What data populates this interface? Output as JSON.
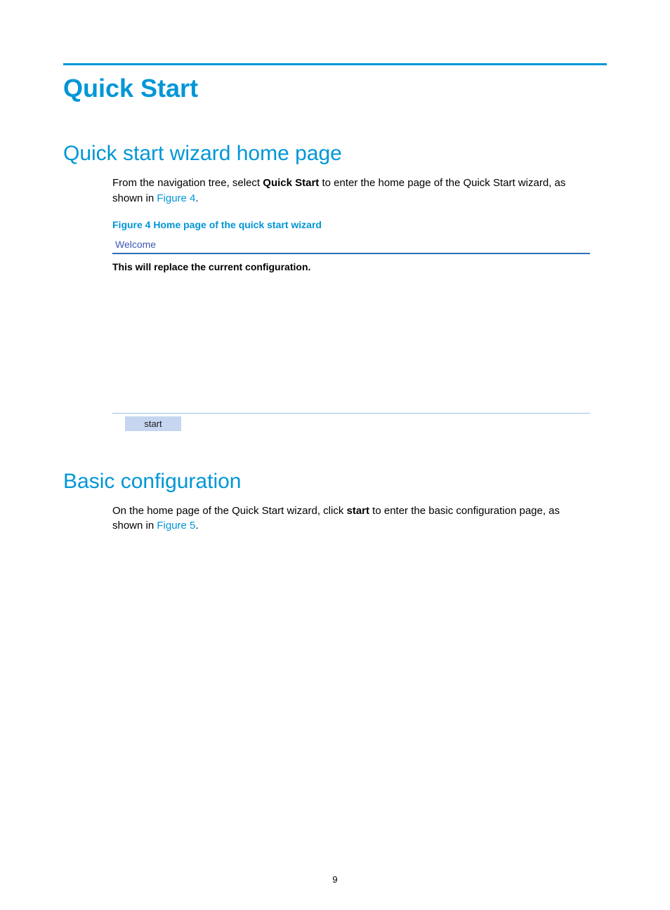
{
  "chapter_title": "Quick Start",
  "section1": {
    "heading": "Quick start wizard home page",
    "para_pre": "From the navigation tree, select ",
    "para_bold": "Quick Start",
    "para_mid": " to enter the home page of the Quick Start wizard, as shown in ",
    "figref": "Figure 4",
    "para_end": "."
  },
  "figure4": {
    "caption": "Figure 4 Home page of the quick start wizard",
    "panel_title": "Welcome",
    "panel_text": "This will replace the current configuration.",
    "start_label": "start"
  },
  "section2": {
    "heading": "Basic configuration",
    "para_pre": "On the home page of the Quick Start wizard, click ",
    "para_bold": "start",
    "para_mid": " to enter the basic configuration page, as shown in ",
    "figref": "Figure 5",
    "para_end": "."
  },
  "page_number": "9"
}
